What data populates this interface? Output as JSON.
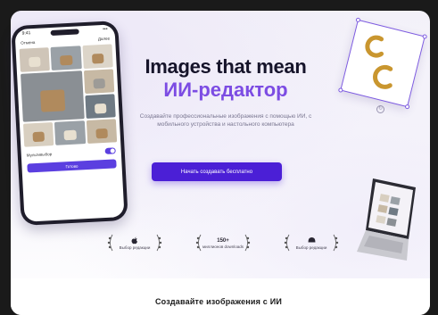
{
  "hero": {
    "headline": "Images that mean",
    "subheadline": "ИИ-редактор",
    "description": "Создавайте профессиональные изображения с помощью ИИ, с мобильного устройства и настольного компьютера",
    "cta_label": "Начать создавать бесплатно"
  },
  "phone": {
    "status_time": "9:41",
    "status_signal": "▪▪▪",
    "app_left": "Отмена",
    "app_right": "Далее",
    "toggle_label": "Мультивыбор",
    "button_label": "Готово"
  },
  "badges": [
    {
      "icon": "apple-icon",
      "number": "",
      "text": "Выбор редакции"
    },
    {
      "icon": "",
      "number": "150+",
      "text": "миллионов downloads"
    },
    {
      "icon": "windows-icon",
      "number": "",
      "text": "Выбор редакции"
    }
  ],
  "bottom": {
    "heading": "Создавайте изображения с ИИ"
  },
  "colors": {
    "accent": "#4b1fd6",
    "subheadline": "#7c4ce3",
    "headline": "#16142a",
    "selection": "#7d5be0",
    "earring_gold": "#c9962f"
  }
}
